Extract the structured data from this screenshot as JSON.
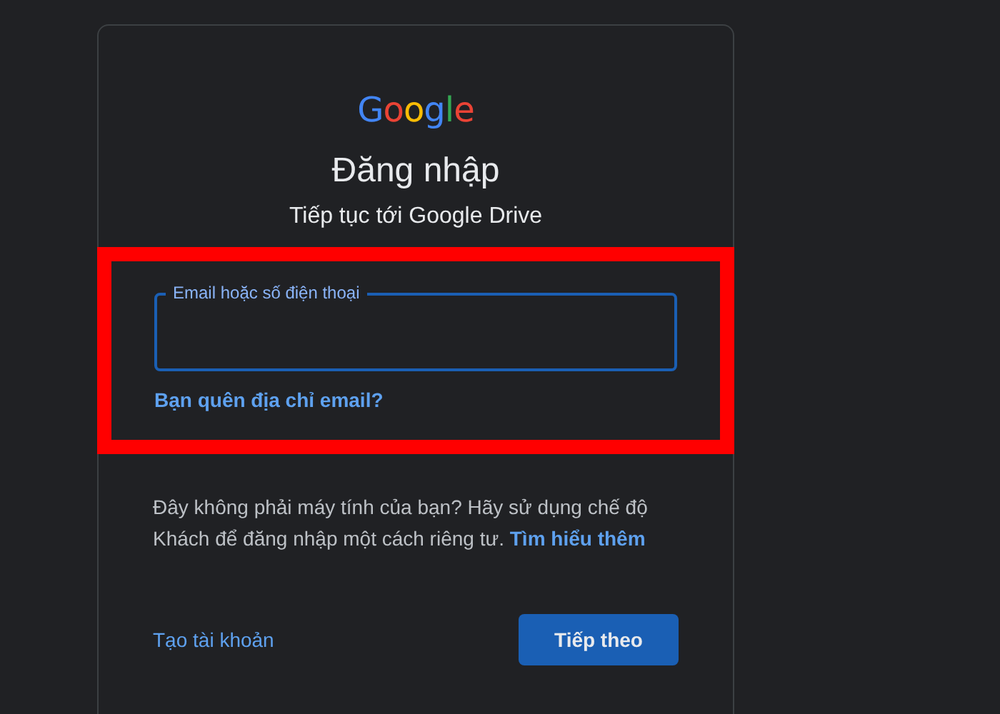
{
  "logo": {
    "text": "Google"
  },
  "title": "Đăng nhập",
  "subtitle": "Tiếp tục tới Google Drive",
  "highlight": {
    "shown": true
  },
  "email_field": {
    "label": "Email hoặc số điện thoại",
    "focused": true
  },
  "forgot_link": "Bạn quên địa chỉ email?",
  "guest_note": {
    "text": "Đây không phải máy tính của bạn? Hãy sử dụng chế độ Khách để đăng nhập một cách riêng tư.",
    "link": "Tìm hiểu thêm"
  },
  "create_account": "Tạo tài khoản",
  "next_button": "Tiếp theo"
}
